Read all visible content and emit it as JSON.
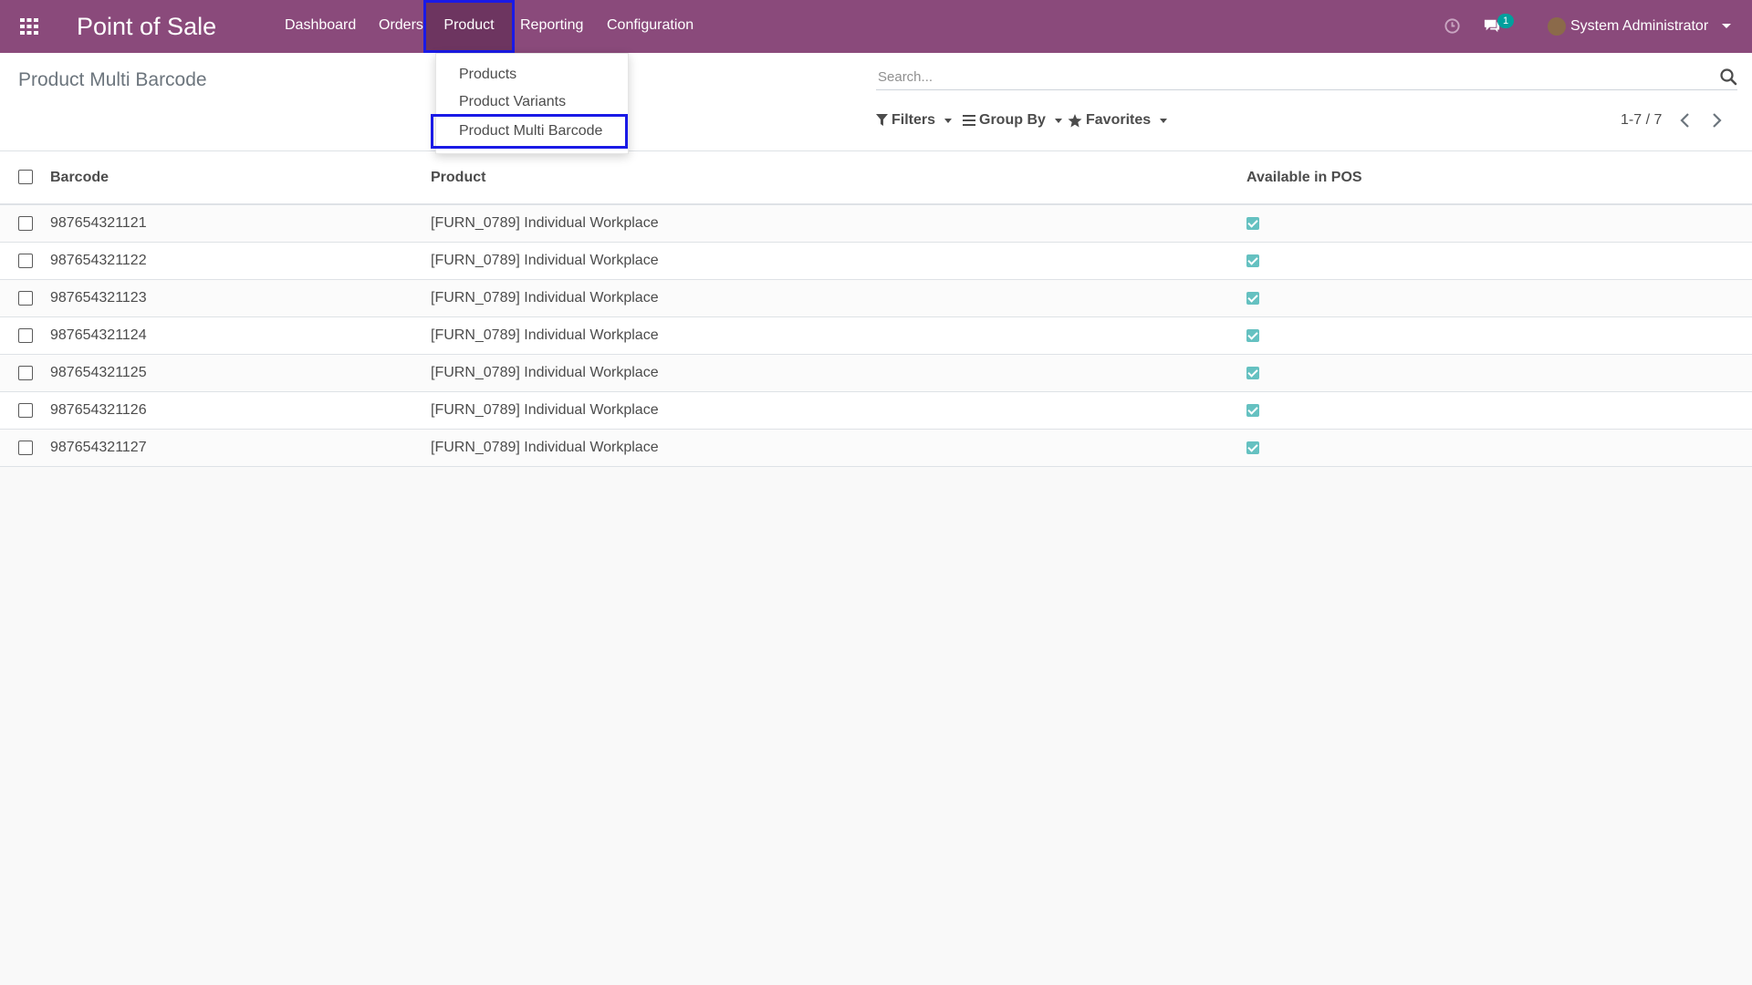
{
  "navbar": {
    "app_title": "Point of Sale",
    "menu": [
      "Dashboard",
      "Orders",
      "Product",
      "Reporting",
      "Configuration"
    ],
    "active_menu": "Product",
    "chat_badge": "1",
    "user_name": "System Administrator"
  },
  "product_menu": {
    "items": [
      "Products",
      "Product Variants",
      "Product Multi Barcode"
    ],
    "highlighted": "Product Multi Barcode"
  },
  "control_panel": {
    "breadcrumb": "Product Multi Barcode",
    "search_placeholder": "Search...",
    "filters_label": "Filters",
    "group_by_label": "Group By",
    "favorites_label": "Favorites",
    "pager": "1-7 / 7"
  },
  "table": {
    "columns": [
      "Barcode",
      "Product",
      "Available in POS"
    ],
    "rows": [
      {
        "barcode": "987654321121",
        "product": "[FURN_0789] Individual Workplace",
        "available_in_pos": true
      },
      {
        "barcode": "987654321122",
        "product": "[FURN_0789] Individual Workplace",
        "available_in_pos": true
      },
      {
        "barcode": "987654321123",
        "product": "[FURN_0789] Individual Workplace",
        "available_in_pos": true
      },
      {
        "barcode": "987654321124",
        "product": "[FURN_0789] Individual Workplace",
        "available_in_pos": true
      },
      {
        "barcode": "987654321125",
        "product": "[FURN_0789] Individual Workplace",
        "available_in_pos": true
      },
      {
        "barcode": "987654321126",
        "product": "[FURN_0789] Individual Workplace",
        "available_in_pos": true
      },
      {
        "barcode": "987654321127",
        "product": "[FURN_0789] Individual Workplace",
        "available_in_pos": true
      }
    ]
  },
  "colors": {
    "navbar": "#8a4a7b",
    "highlight_border": "#1a1ae6",
    "badge": "#00a09d",
    "checkbox_checked": "#65c1c1"
  },
  "icons": [
    "apps-grid-icon",
    "clock-icon",
    "chat-icon",
    "search-icon",
    "filter-icon",
    "group-by-icon",
    "star-icon",
    "chevron-left-icon",
    "chevron-right-icon",
    "caret-down-icon"
  ]
}
